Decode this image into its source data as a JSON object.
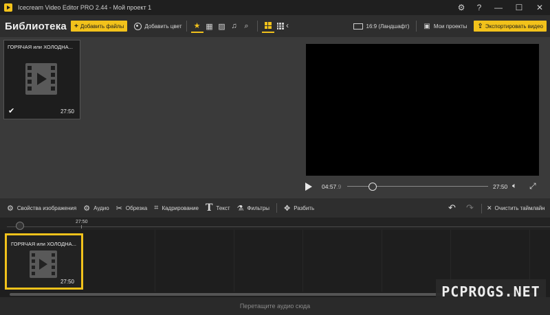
{
  "window": {
    "title": "Icecream Video Editor PRO 2.44  -  Мой проект 1",
    "settings_icon": "gear-icon",
    "help_icon": "question-icon"
  },
  "library": {
    "title": "Библиотека",
    "add_files_label": "Добавить файлы",
    "add_color_label": "Добавить цвет",
    "clips": [
      {
        "title": "ГОРЯЧАЯ или ХОЛОДНА...",
        "duration": "27:50",
        "selected": true
      }
    ]
  },
  "player_header": {
    "aspect_label": "16:9 (Ландшафт)",
    "projects_label": "Мои проекты",
    "export_label": "Экспортировать видео"
  },
  "player": {
    "current_time": "04:57",
    "current_frac": ".9",
    "total_time": "27:50",
    "progress_fraction": 0.18
  },
  "tools": {
    "image_props": "Свойства изображения",
    "audio": "Аудио",
    "trim": "Обрезка",
    "crop": "Кадрирование",
    "text_icon_glyph": "T",
    "text": "Текст",
    "filters": "Фильтры",
    "split": "Разбить",
    "clear_timeline": "Очистить таймлайн"
  },
  "timeline": {
    "ruler_label": "27:50",
    "clip": {
      "title": "ГОРЯЧАЯ или ХОЛОДНА...",
      "duration": "27:50"
    },
    "audio_drop_hint": "Перетащите аудио сюда"
  },
  "watermark": {
    "text": "PCPROGS.NET"
  },
  "colors": {
    "accent": "#f2c21b",
    "background": "#2b2b2b",
    "panel": "#3a3a3a",
    "video": "#000000"
  }
}
